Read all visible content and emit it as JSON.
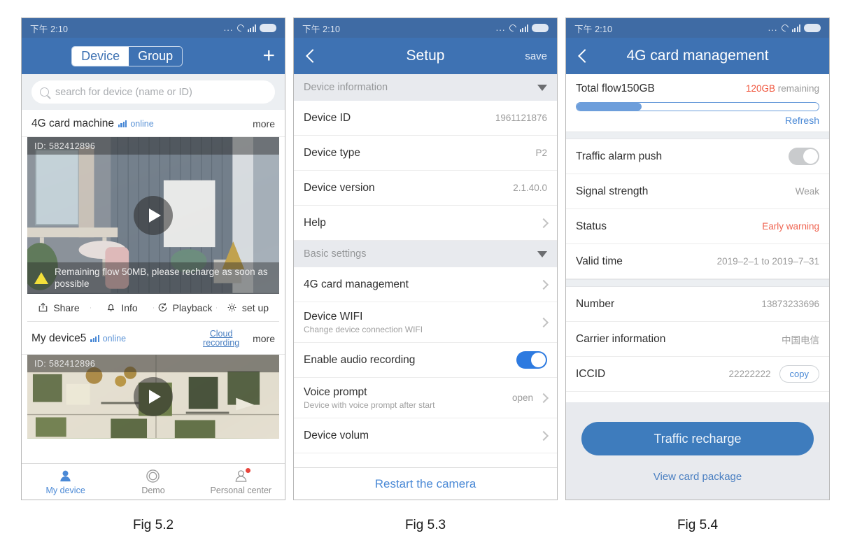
{
  "statusbar": {
    "time": "下午 2:10",
    "dots": "...",
    "icons": [
      "loading-circle-icon",
      "signal-bars-icon",
      "battery-icon"
    ]
  },
  "panel1": {
    "nav": {
      "tabs": [
        {
          "label": "Device",
          "active": true
        },
        {
          "label": "Group",
          "active": false
        }
      ],
      "add_label": "+"
    },
    "search": {
      "placeholder": "search for device (name or ID)",
      "icon": "search-icon"
    },
    "devices": [
      {
        "name": "4G card machine",
        "status": "online",
        "more_label": "more",
        "cloud_label": "",
        "video_id": "ID: 582412896",
        "warning": "Remaining flow 50MB, please recharge as soon as possible",
        "tools": [
          {
            "label": "Share",
            "icon": "share-icon"
          },
          {
            "label": "Info",
            "icon": "bell-icon"
          },
          {
            "label": "Playback",
            "icon": "replay-icon"
          },
          {
            "label": "set up",
            "icon": "gear-icon"
          }
        ]
      },
      {
        "name": "My device5",
        "status": "online",
        "more_label": "more",
        "cloud_label": "Cloud recording",
        "video_id": "ID: 582412896"
      }
    ],
    "tabbar": [
      {
        "label": "My device",
        "icon": "camera-icon",
        "active": true,
        "badge": false
      },
      {
        "label": "Demo",
        "icon": "circle-lens-icon",
        "active": false,
        "badge": false
      },
      {
        "label": "Personal center",
        "icon": "person-icon",
        "active": false,
        "badge": true
      }
    ]
  },
  "panel2": {
    "nav": {
      "title": "Setup",
      "back": "back-icon",
      "save_label": "save"
    },
    "sections": [
      {
        "header": "Device information",
        "rows": [
          {
            "title": "Device ID",
            "value": "1961121876",
            "chevron": false
          },
          {
            "title": "Device type",
            "value": "P2",
            "chevron": false
          },
          {
            "title": "Device version",
            "value": "2.1.40.0",
            "chevron": false
          },
          {
            "title": "Help",
            "value": "",
            "chevron": true
          }
        ]
      },
      {
        "header": "Basic settings",
        "rows": [
          {
            "title": "4G card management",
            "value": "",
            "chevron": true
          },
          {
            "title": "Device WIFI",
            "sub": "Change device connection WIFI",
            "value": "",
            "chevron": true
          },
          {
            "title": "Enable audio recording",
            "toggle": "on"
          },
          {
            "title": "Voice prompt",
            "sub": "Device with voice prompt after start",
            "value": "open",
            "chevron": true
          },
          {
            "title": "Device volum",
            "value": "",
            "chevron": true
          }
        ]
      }
    ],
    "footer": "Restart the camera"
  },
  "panel3": {
    "nav": {
      "title": "4G card management",
      "back": "back-icon"
    },
    "flow": {
      "total_label": "Total flow150GB",
      "remaining_value": "120GB",
      "remaining_suffix": " remaining",
      "percent": 27,
      "refresh_label": "Refresh"
    },
    "rows": [
      {
        "title": "Traffic alarm push",
        "toggle": "off"
      },
      {
        "title": "Signal strength",
        "value": "Weak"
      },
      {
        "title": "Status",
        "value": "Early warning",
        "red": true
      },
      {
        "title": "Valid time",
        "value": "2019–2–1 to 2019–7–31"
      },
      {
        "title": "Number",
        "value": "13873233696"
      },
      {
        "title": "Carrier information",
        "value": "中国电信"
      },
      {
        "title": "ICCID",
        "value": "22222222",
        "copy": "copy"
      }
    ],
    "cta": {
      "primary": "Traffic recharge",
      "link": "View card package"
    }
  },
  "captions": {
    "fig1": "Fig 5.2",
    "fig2": "Fig 5.3",
    "fig3": "Fig 5.4"
  },
  "colors": {
    "nav_blue": "#3e72b3",
    "status_blue": "#3f6ba4",
    "accent": "#4a89d6",
    "danger": "#ef6552",
    "progress": "#6d9edb"
  }
}
